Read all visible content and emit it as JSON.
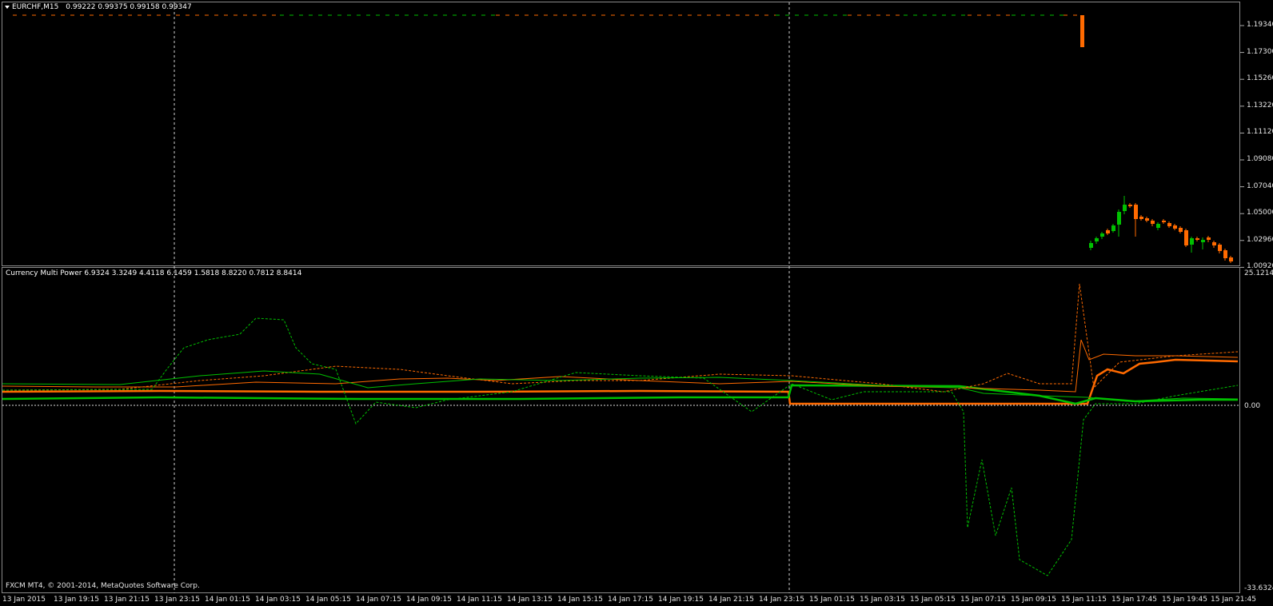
{
  "price_chart": {
    "symbol_tf": "EURCHF,M15",
    "ohlc": "0.99222 0.99375 0.99158 0.99347",
    "y_ticks": [
      "1.19340",
      "1.17300",
      "1.15260",
      "1.13220",
      "1.11120",
      "1.09080",
      "1.07040",
      "1.05000",
      "1.02960",
      "1.00920"
    ],
    "bull_color": "#00c000",
    "bear_color": "#ff6a00"
  },
  "indicator": {
    "label": "Currency Multi Power 6.9324 3.3249 4.4118 6.1459 1.5818 8.8220 0.7812 8.8414",
    "max": "25.1214",
    "zero": "0.00",
    "min": "-33.6324",
    "colors": {
      "orange": "#ff6a00",
      "green": "#00c000"
    }
  },
  "time_axis": [
    "13 Jan 2015",
    "13 Jan 19:15",
    "13 Jan 21:15",
    "13 Jan 23:15",
    "14 Jan 01:15",
    "14 Jan 03:15",
    "14 Jan 05:15",
    "14 Jan 07:15",
    "14 Jan 09:15",
    "14 Jan 11:15",
    "14 Jan 13:15",
    "14 Jan 15:15",
    "14 Jan 17:15",
    "14 Jan 19:15",
    "14 Jan 21:15",
    "14 Jan 23:15",
    "15 Jan 01:15",
    "15 Jan 03:15",
    "15 Jan 05:15",
    "15 Jan 07:15",
    "15 Jan 09:15",
    "15 Jan 11:15",
    "15 Jan 17:45",
    "15 Jan 19:45",
    "15 Jan 21:45"
  ],
  "footer": "FXCM MT4, © 2001-2014, MetaQuotes Software Corp."
}
